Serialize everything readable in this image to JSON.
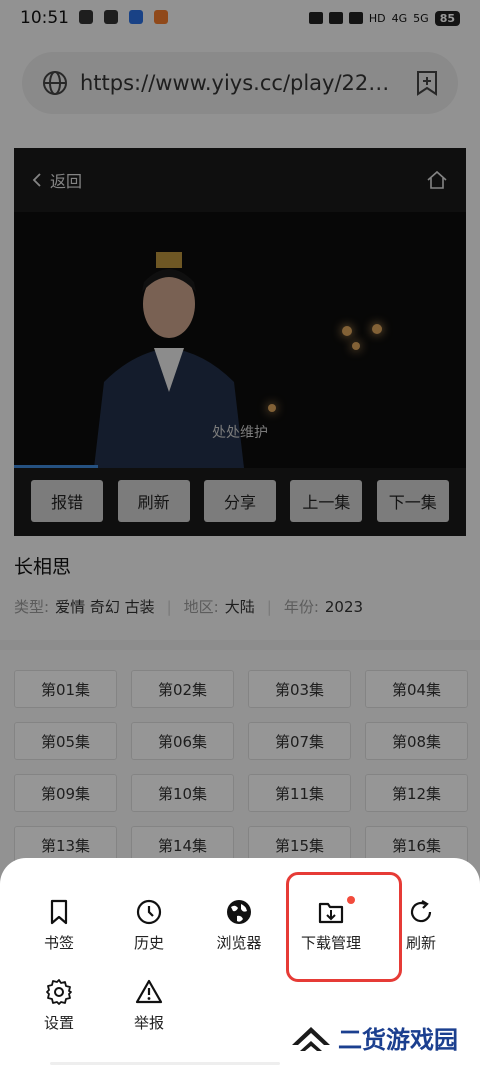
{
  "status": {
    "time": "10:51",
    "battery": "85",
    "net1": "HD",
    "net2": "4G",
    "net3": "5G"
  },
  "urlbar": {
    "url": "https://www.yiys.cc/play/22…"
  },
  "player": {
    "back_label": "返回",
    "caption": "处处维护",
    "buttons": [
      "报错",
      "刷新",
      "分享",
      "上一集",
      "下一集"
    ]
  },
  "show": {
    "title": "长相思",
    "type_label": "类型:",
    "types": "爱情 奇幻 古装",
    "region_label": "地区:",
    "region": "大陆",
    "year_label": "年份:",
    "year": "2023"
  },
  "episodes": [
    "第01集",
    "第02集",
    "第03集",
    "第04集",
    "第05集",
    "第06集",
    "第07集",
    "第08集",
    "第09集",
    "第10集",
    "第11集",
    "第12集",
    "第13集",
    "第14集",
    "第15集",
    "第16集"
  ],
  "menu": {
    "bookmark": "书签",
    "history": "历史",
    "browser": "浏览器",
    "downloads": "下载管理",
    "refresh": "刷新",
    "settings": "设置",
    "report": "举报"
  },
  "watermark": {
    "text": "二货游戏园"
  },
  "colors": {
    "accent_red": "#e63b36",
    "progress_blue": "#3f87d8"
  }
}
